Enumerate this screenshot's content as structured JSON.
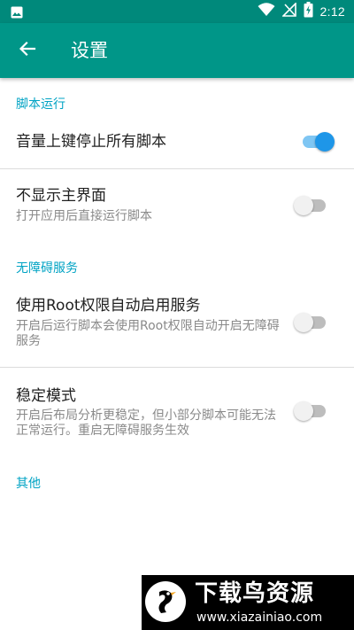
{
  "status_bar": {
    "time": "2:12",
    "icons": [
      "image-icon",
      "wifi-icon",
      "no-signal-icon",
      "battery-charging-icon"
    ]
  },
  "app_bar": {
    "title": "设置",
    "back_icon": "arrow-back-icon"
  },
  "sections": [
    {
      "header": "脚本运行",
      "items": [
        {
          "title": "音量上键停止所有脚本",
          "summary": "",
          "enabled": true
        },
        {
          "title": "不显示主界面",
          "summary": "打开应用后直接运行脚本",
          "enabled": false
        }
      ]
    },
    {
      "header": "无障碍服务",
      "items": [
        {
          "title": "使用Root权限自动启用服务",
          "summary": "开启后运行脚本会使用Root权限自动开启无障碍服务",
          "enabled": false
        },
        {
          "title": "稳定模式",
          "summary": "开启后布局分析更稳定，但小部分脚本可能无法正常运行。重启无障碍服务生效",
          "enabled": false
        }
      ]
    },
    {
      "header": "其他",
      "items": []
    }
  ],
  "watermark": {
    "text": "下载鸟资源",
    "url": "www.xiazainiao.com"
  },
  "colors": {
    "status_bar": "#00897b",
    "app_bar": "#009688",
    "accent": "#00a3c4",
    "switch_on": "#1e96e8"
  }
}
